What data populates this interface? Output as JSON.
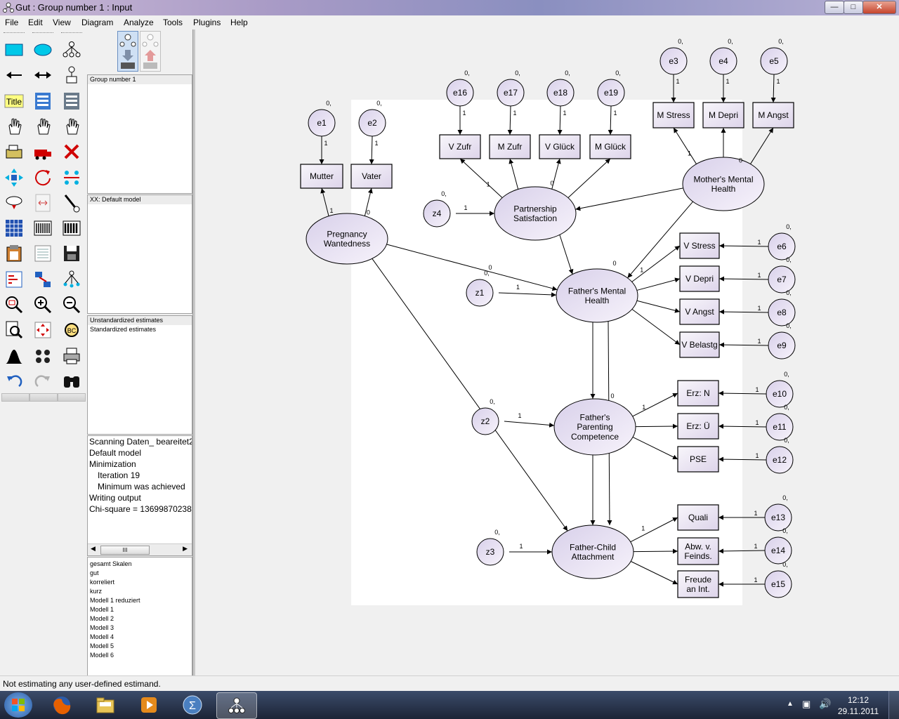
{
  "window": {
    "title": "Gut : Group number 1 : Input"
  },
  "menu": [
    "File",
    "Edit",
    "View",
    "Diagram",
    "Analyze",
    "Tools",
    "Plugins",
    "Help"
  ],
  "tools": [
    "rectangle-tool",
    "ellipse-tool",
    "indicator-tool",
    "path-tool",
    "covariance-tool",
    "unique-variable-tool",
    "title-tool",
    "list-variables-tool",
    "list-data-variables-tool",
    "select-one-tool",
    "select-all-tool",
    "deselect-all-tool",
    "duplicate-tool",
    "move-tool",
    "erase-tool",
    "resize-tool",
    "rotate-tool",
    "reflect-tool",
    "move-parameter-tool",
    "scroll-tool",
    "touch-up-tool",
    "data-file-tool",
    "analysis-properties-tool",
    "calculate-tool",
    "copy-tool",
    "view-text-tool",
    "save-tool",
    "object-properties-tool",
    "drag-properties-tool",
    "preserve-symmetries-tool",
    "zoom-area-tool",
    "zoom-in-tool",
    "zoom-out-tool",
    "zoom-page-tool",
    "fit-page-tool",
    "loupe-tool",
    "bayesian-tool",
    "multiple-group-tool",
    "print-tool",
    "undo-tool",
    "redo-tool",
    "search-tool"
  ],
  "title_label": "Title",
  "panels": {
    "groups": [
      "Group number 1"
    ],
    "models": [
      "XX: Default model"
    ],
    "estimates": [
      "Unstandardized estimates",
      "Standardized estimates"
    ],
    "messages": [
      "Scanning Daten_ beareitet2",
      "Default model",
      "Minimization",
      "Iteration 19",
      "Minimum was achieved",
      "Writing output",
      "Chi-square = 13699870238"
    ],
    "files": [
      "gesamt Skalen",
      "gut",
      "korreliert",
      "kurz",
      "Modell 1 reduziert",
      "Modell 1",
      "Modell 2",
      "Modell 3",
      "Modell 4",
      "Modell 5",
      "Modell 6"
    ],
    "scroll_thumb": "III"
  },
  "status": "Not estimating any user-defined estimand.",
  "clock": {
    "time": "12:12",
    "date": "29.11.2011"
  },
  "diagram": {
    "ellipses": [
      {
        "id": "pw",
        "label": "Pregnancy\nWantedness"
      },
      {
        "id": "ps",
        "label": "Partnership\nSatisfaction"
      },
      {
        "id": "mmh",
        "label": "Mother's Mental\nHealth"
      },
      {
        "id": "fmh",
        "label": "Father's Mental\nHealth"
      },
      {
        "id": "fpc",
        "label": "Father's\nParenting\nCompetence"
      },
      {
        "id": "fca",
        "label": "Father-Child\nAttachment"
      }
    ],
    "circles": [
      "e1",
      "e2",
      "e3",
      "e4",
      "e5",
      "e16",
      "e17",
      "e18",
      "e19",
      "z4",
      "z1",
      "z2",
      "z3",
      "e6",
      "e7",
      "e8",
      "e9",
      "e10",
      "e11",
      "e12",
      "e13",
      "e14",
      "e15"
    ],
    "boxes": [
      "Mutter",
      "Vater",
      "V Zufr",
      "M Zufr",
      "V Glück",
      "M Glück",
      "M Stress",
      "M Depri",
      "M Angst",
      "V Stress",
      "V Depri",
      "V Angst",
      "V Belastg",
      "Erz: N",
      "Erz: Ü",
      "PSE",
      "Quali",
      "Abw. v.\nFeinds.",
      "Freude\nan Int."
    ],
    "path_label": "1",
    "variance_label": "0,",
    "zero_label": "0"
  }
}
